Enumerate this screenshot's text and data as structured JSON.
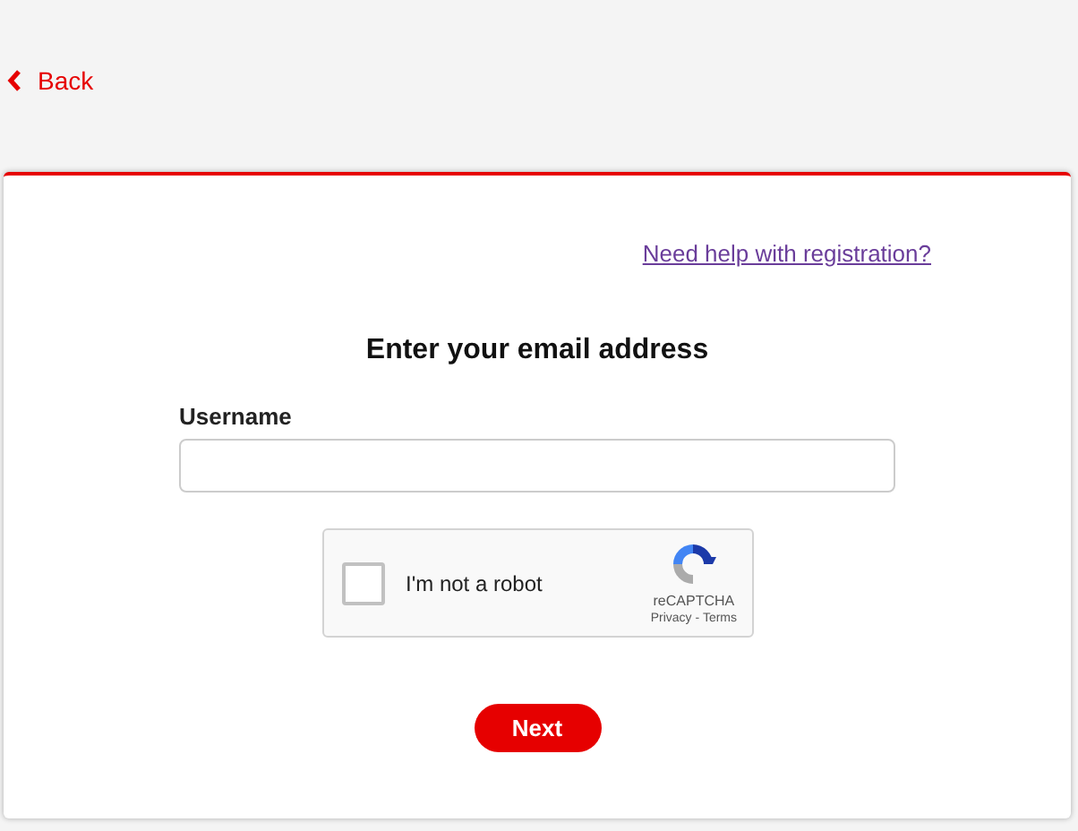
{
  "back_link": {
    "label": "Back"
  },
  "help_link": "Need help with registration?",
  "heading": "Enter your email address",
  "username_field": {
    "label": "Username"
  },
  "captcha": {
    "label": "I'm not a robot",
    "checked": false,
    "brand": "reCAPTCHA",
    "privacy": "Privacy",
    "separator": "-",
    "terms": "Terms"
  },
  "next_button": "Next"
}
